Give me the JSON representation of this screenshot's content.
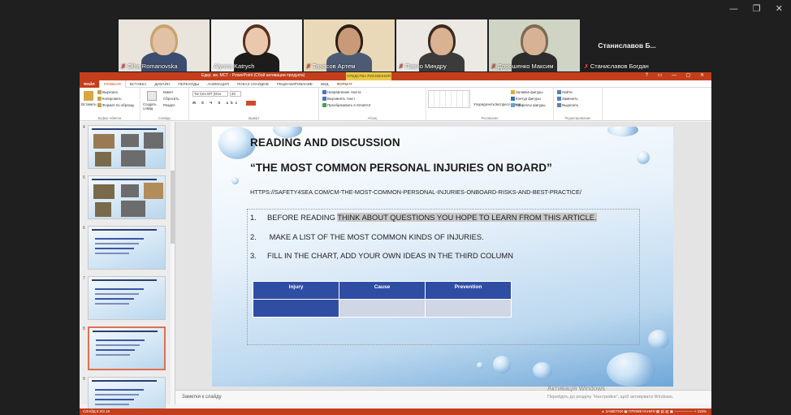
{
  "zoom": {
    "window_controls": [
      "—",
      "❐",
      "✕"
    ],
    "participants": [
      {
        "name": "Olha Romanovska",
        "muted": true,
        "bg": "#e9e4dc",
        "skin": "#e2c2a6",
        "hair": "#c9a36d",
        "shirt": "#3c4c6e"
      },
      {
        "name": "Alyona Katrych",
        "muted": false,
        "bg": "#f2f2f0",
        "skin": "#e9c8ae",
        "hair": "#5a2f1e",
        "shirt": "#1c1c1c",
        "active": true
      },
      {
        "name": "Танасов Артем",
        "muted": true,
        "bg": "#e9d9b9",
        "skin": "#c89a78",
        "hair": "#2a1d14",
        "shirt": "#4d5a73"
      },
      {
        "name": "Павло Миндру",
        "muted": true,
        "bg": "#ece9e5",
        "skin": "#d9b193",
        "hair": "#3a2a20",
        "shirt": "#3b3b3b"
      },
      {
        "name": "Дорошенко Максим",
        "muted": true,
        "bg": "#cfd4c4",
        "skin": "#d8b295",
        "hair": "#7c6b52",
        "shirt": "#2c2c2c"
      },
      {
        "name": "Станиславов Богдан",
        "muted": true,
        "text_only": true,
        "big": "Станиславов  Б..."
      }
    ]
  },
  "ppt": {
    "title": "Едкр. зм. МСТ - PowerPoint (Сбой активации продукта)",
    "tools_label": "СРЕДСТВА РИСОВАНИЯ",
    "window_buttons": "? ▭ — ▢ ✕",
    "tabs": [
      "ФАЙЛ",
      "ГЛАВНАЯ",
      "ВСТАВКА",
      "ДИЗАЙН",
      "ПЕРЕХОДЫ",
      "АНИМАЦИЯ",
      "ПОКАЗ СЛАЙДОВ",
      "РЕЦЕНЗИРОВАНИЕ",
      "ВИД",
      "ФОРМАТ"
    ],
    "ribbon": {
      "clipboard": {
        "paste": "Вставить",
        "cut": "Вырезать",
        "copy": "Копировать",
        "format": "Формат по образцу",
        "label": "Буфер обмена"
      },
      "slides": {
        "new": "Создать слайд",
        "layout": "Макет",
        "reset": "Сбросить",
        "section": "Раздел",
        "label": "Слайды"
      },
      "font": {
        "name": "Tw Cen MT (Осн",
        "size": "20",
        "label": "Шрифт"
      },
      "paragraph": {
        "dir": "Направление текста",
        "align": "Выровнять текст",
        "smart": "Преобразовать в SmartArt",
        "label": "Абзац"
      },
      "drawing": {
        "arrange": "Упорядочить",
        "styles": "Экспресс-стили",
        "fill": "Заливка фигуры",
        "outline": "Контур фигуры",
        "effects": "Эффекты фигуры",
        "label": "Рисование"
      },
      "editing": {
        "find": "Найти",
        "replace": "Заменить",
        "select": "Выделить",
        "label": "Редактирование"
      }
    },
    "thumbs": [
      {
        "num": "4",
        "selected": false
      },
      {
        "num": "5",
        "selected": false
      },
      {
        "num": "6",
        "selected": false
      },
      {
        "num": "7",
        "selected": false
      },
      {
        "num": "8",
        "selected": true
      },
      {
        "num": "9",
        "selected": false
      }
    ],
    "slide": {
      "title": "READING AND DISCUSSION",
      "subtitle": "“THE MOST COMMON PERSONAL INJURIES ON BOARD”",
      "url": "HTTPS://SAFETY4SEA.COM/CM-THE-MOST-COMMON-PERSONAL-INJURIES-ONBOARD-RISKS-AND-BEST-PRACTICE/",
      "items": [
        {
          "n": "1.",
          "text": "BEFORE READING ",
          "highlight": "THINK ABOUT QUESTIONS YOU HOPE TO LEARN FROM THIS ARTICLE."
        },
        {
          "n": "2.",
          "text": " MAKE A LIST OF THE MOST COMMON KINDS OF INJURIES.",
          "highlight": ""
        },
        {
          "n": "3.",
          "text": "FILL IN THE CHART, ADD YOUR OWN IDEAS IN THE THIRD COLUMN",
          "highlight": ""
        }
      ],
      "table_headers": [
        "Injury",
        "Cause",
        "Prevention"
      ]
    },
    "notes_placeholder": "Заметки к слайду",
    "status_left": "СЛАЙД 8 ИЗ 19",
    "status_right": "≐ ЗАМЕТКИ   ▣ ПРИМЕЧАНИЯ   ▦ ▤ ▥ ▣   —————  + 119%",
    "watermark_title": "Активація Windows",
    "watermark_sub": "Перейдіть до розділу \"Настройки\", щоб активувати Windows."
  }
}
